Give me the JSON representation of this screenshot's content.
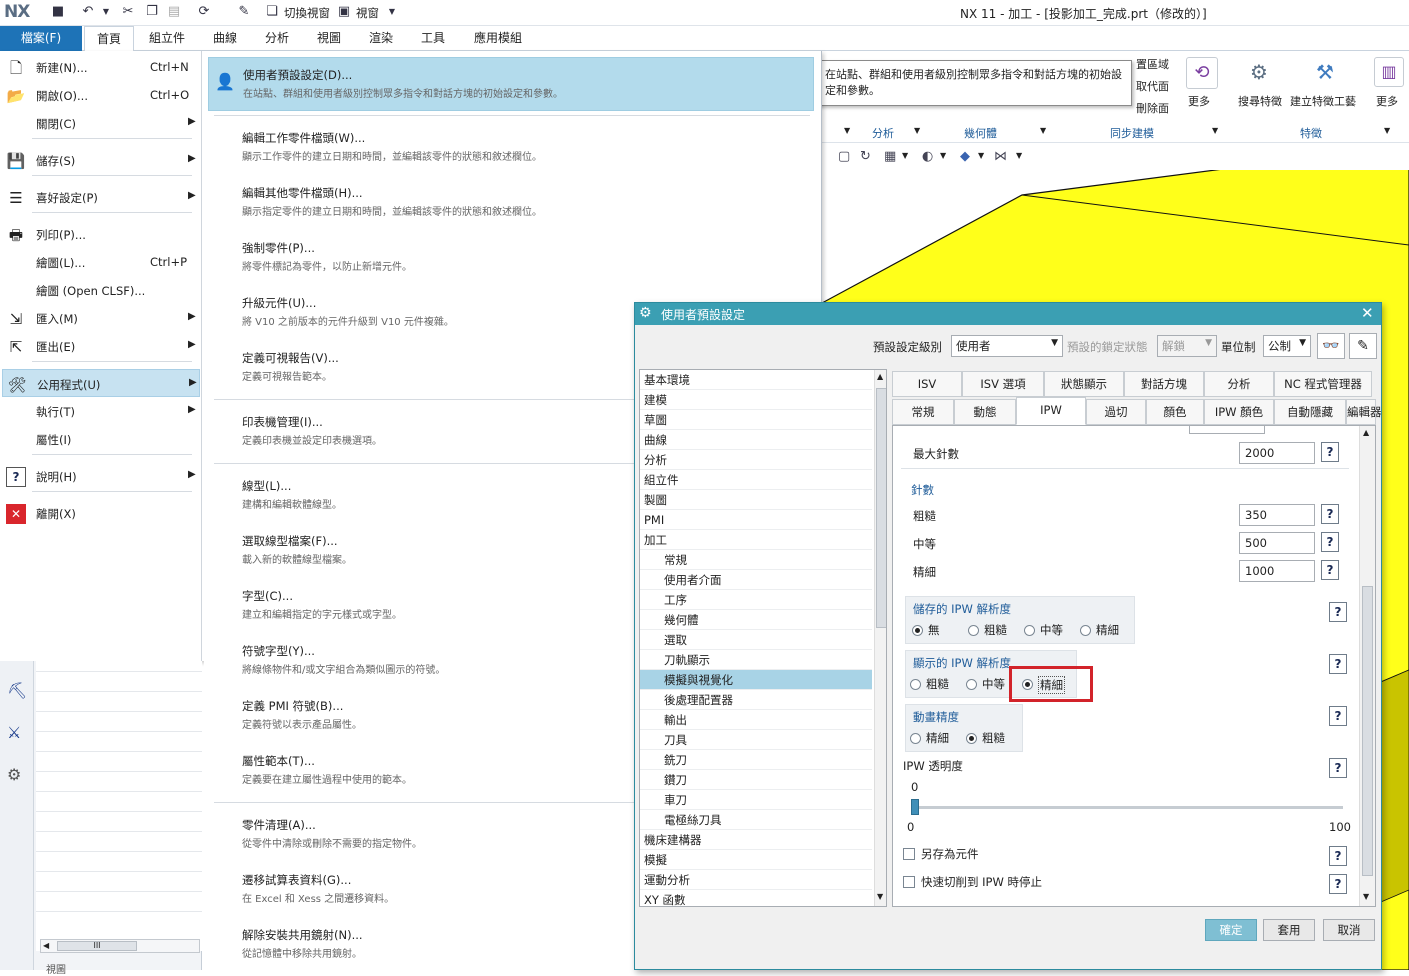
{
  "app": {
    "logo": "NX",
    "window_title": "NX 11 - 加工 - [投影加工_完成.prt（修改的）]"
  },
  "quick_access": {
    "switch_window": "切換視窗",
    "window": "視窗"
  },
  "ribbon_tabs": {
    "file": "檔案(F)",
    "tabs": [
      "首頁",
      "組立件",
      "曲線",
      "分析",
      "視圖",
      "渲染",
      "工具",
      "應用模組"
    ]
  },
  "ribbon_right": {
    "small_items": [
      "置區域",
      "取代面",
      "刪除面"
    ],
    "more1": "更多",
    "search_feature": "搜尋特徵",
    "build_feature_tool": "建立特徵工藝",
    "more2": "更多",
    "groups": [
      "分析",
      "幾何體",
      "同步建模",
      "特徵"
    ]
  },
  "tooltip": {
    "text": "在站點、群組和使用者級別控制眾多指令和對話方塊的初始設定和參數。"
  },
  "file_menu": {
    "items": [
      {
        "label": "新建(N)...",
        "shortcut": "Ctrl+N",
        "arrow": ""
      },
      {
        "label": "開啟(O)...",
        "shortcut": "Ctrl+O",
        "arrow": ""
      },
      {
        "label": "關閉(C)",
        "shortcut": "",
        "arrow": "▶"
      },
      {
        "label": "儲存(S)",
        "shortcut": "",
        "arrow": "▶"
      },
      {
        "label": "喜好設定(P)",
        "shortcut": "",
        "arrow": "▶"
      },
      {
        "label": "列印(P)...",
        "shortcut": "",
        "arrow": ""
      },
      {
        "label": "繪圖(L)...",
        "shortcut": "Ctrl+P",
        "arrow": ""
      },
      {
        "label": "繪圖 (Open CLSF)...",
        "shortcut": "",
        "arrow": ""
      },
      {
        "label": "匯入(M)",
        "shortcut": "",
        "arrow": "▶"
      },
      {
        "label": "匯出(E)",
        "shortcut": "",
        "arrow": "▶"
      },
      {
        "label": "公用程式(U)",
        "shortcut": "",
        "arrow": "▶"
      },
      {
        "label": "執行(T)",
        "shortcut": "",
        "arrow": "▶"
      },
      {
        "label": "屬性(I)",
        "shortcut": "",
        "arrow": ""
      },
      {
        "label": "說明(H)",
        "shortcut": "",
        "arrow": "▶"
      },
      {
        "label": "離開(X)",
        "shortcut": "",
        "arrow": ""
      }
    ]
  },
  "utilities_submenu": [
    {
      "title": "使用者預設設定(D)...",
      "desc": "在站點、群組和使用者級別控制眾多指令和對話方塊的初始設定和參數。"
    },
    {
      "title": "編輯工作零件檔頭(W)...",
      "desc": "顯示工作零件的建立日期和時間，並編輯該零件的狀態和敘述欄位。"
    },
    {
      "title": "編輯其他零件檔頭(H)...",
      "desc": "顯示指定零件的建立日期和時間，並編輯該零件的狀態和敘述欄位。"
    },
    {
      "title": "強制零件(P)...",
      "desc": "將零件標記為零件，以防止新增元件。"
    },
    {
      "title": "升級元件(U)...",
      "desc": "將 V10 之前版本的元件升級到 V10 元件複雜。"
    },
    {
      "title": "定義可視報告(V)...",
      "desc": "定義可視報告範本。"
    },
    {
      "title": "印表機管理(I)...",
      "desc": "定義印表機並設定印表機選項。"
    },
    {
      "title": "線型(L)...",
      "desc": "建構和編輯軟體線型。"
    },
    {
      "title": "選取線型檔案(F)...",
      "desc": "載入新的軟體線型檔案。"
    },
    {
      "title": "字型(C)...",
      "desc": "建立和編輯指定的字元樣式或字型。"
    },
    {
      "title": "符號字型(Y)...",
      "desc": "將線條物件和/或文字組合為類似圖示的符號。"
    },
    {
      "title": "定義 PMI 符號(B)...",
      "desc": "定義符號以表示產品屬性。"
    },
    {
      "title": "屬性範本(T)...",
      "desc": "定義要在建立屬性過程中使用的範本。"
    },
    {
      "title": "零件清理(A)...",
      "desc": "從零件中清除或刪除不需要的指定物件。"
    },
    {
      "title": "遷移試算表資料(G)...",
      "desc": "在 Excel 和 Xess 之間遷移資料。"
    },
    {
      "title": "解除安裝共用鏡射(N)...",
      "desc": "從記憶體中移除共用鏡射。"
    }
  ],
  "left_lower": {
    "scroll_label": "III",
    "bottom_text": "視圖"
  },
  "dialog": {
    "title": "使用者預設設定",
    "level_label": "預設設定級別",
    "level_value": "使用者",
    "lock_label": "預設的鎖定狀態",
    "lock_value": "解鎖",
    "unit_label": "單位制",
    "unit_value": "公制",
    "tree": [
      {
        "label": "基本環境",
        "indent": 0
      },
      {
        "label": "建模",
        "indent": 0
      },
      {
        "label": "草圖",
        "indent": 0
      },
      {
        "label": "曲線",
        "indent": 0
      },
      {
        "label": "分析",
        "indent": 0
      },
      {
        "label": "組立件",
        "indent": 0
      },
      {
        "label": "製圖",
        "indent": 0
      },
      {
        "label": "PMI",
        "indent": 0
      },
      {
        "label": "加工",
        "indent": 0
      },
      {
        "label": "常規",
        "indent": 1
      },
      {
        "label": "使用者介面",
        "indent": 1
      },
      {
        "label": "工序",
        "indent": 1
      },
      {
        "label": "幾何體",
        "indent": 1
      },
      {
        "label": "選取",
        "indent": 1
      },
      {
        "label": "刀軌顯示",
        "indent": 1
      },
      {
        "label": "模擬與視覺化",
        "indent": 1
      },
      {
        "label": "後處理配置器",
        "indent": 1
      },
      {
        "label": "輸出",
        "indent": 1
      },
      {
        "label": "刀具",
        "indent": 1
      },
      {
        "label": "銑刀",
        "indent": 1
      },
      {
        "label": "鑽刀",
        "indent": 1
      },
      {
        "label": "車刀",
        "indent": 1
      },
      {
        "label": "電極絲刀具",
        "indent": 1
      },
      {
        "label": "機床建構器",
        "indent": 0
      },
      {
        "label": "模擬",
        "indent": 0
      },
      {
        "label": "運動分析",
        "indent": 0
      },
      {
        "label": "XY 函數",
        "indent": 0
      }
    ],
    "selected_tree_item": "模擬與視覺化",
    "tabs_row1": [
      "ISV",
      "ISV 選項",
      "狀態顯示",
      "對話方塊",
      "分析",
      "NC 程式管理器"
    ],
    "tabs_row2": [
      "常規",
      "動態",
      "IPW",
      "過切",
      "顏色",
      "IPW 顏色",
      "自動隱藏",
      "編輯器"
    ],
    "active_tab": "IPW",
    "max_steps_label": "最大針數",
    "max_steps_value": "2000",
    "steps_group": "針數",
    "coarse_label": "粗糙",
    "coarse_value": "350",
    "medium_label": "中等",
    "medium_value": "500",
    "fine_label": "精細",
    "fine_value": "1000",
    "saved_ipw_title": "儲存的 IPW 解析度",
    "saved_ipw_options": [
      "無",
      "粗糙",
      "中等",
      "精細"
    ],
    "saved_ipw_selected": 0,
    "display_ipw_title": "顯示的 IPW 解析度",
    "display_ipw_options": [
      "粗糙",
      "中等",
      "精細"
    ],
    "display_ipw_selected": 2,
    "anim_title": "動畫精度",
    "anim_options": [
      "精細",
      "粗糙"
    ],
    "anim_selected": 1,
    "transparency_label": "IPW 透明度",
    "transparency_value": "0",
    "slider_min": "0",
    "slider_max": "100",
    "slider_fraction": 0,
    "save_as_component": "另存為元件",
    "stop_on_gouge": "快速切削到 IPW 時停止",
    "help_glyph": "?",
    "buttons": {
      "ok": "確定",
      "apply": "套用",
      "cancel": "取消"
    }
  },
  "colors": {
    "accent": "#1e73b7",
    "dialog_title": "#3b9fb3",
    "model": "#ffff1a",
    "highlight": "#d2232a"
  }
}
